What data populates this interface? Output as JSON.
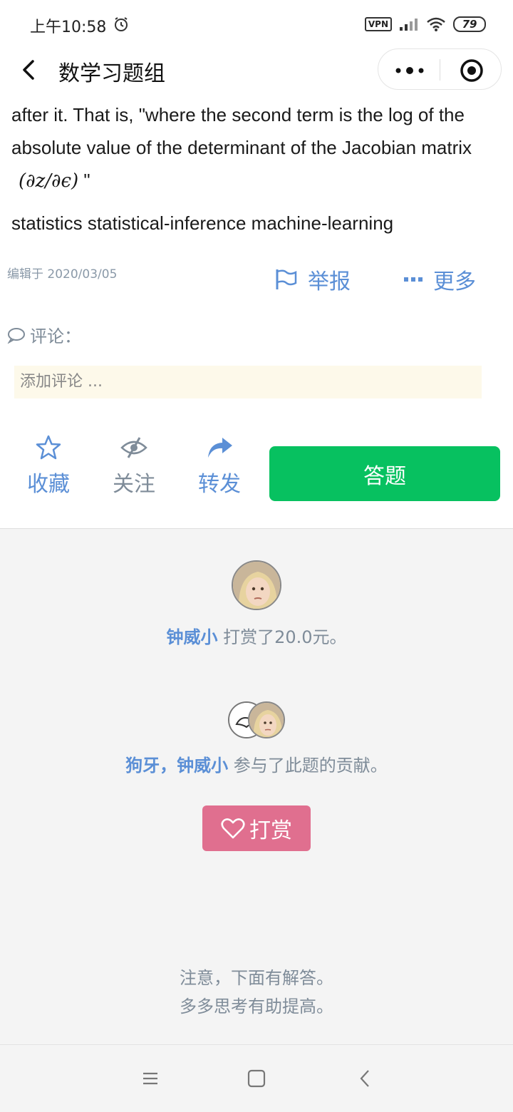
{
  "status": {
    "time": "上午10:58",
    "vpn": "VPN",
    "battery": "79"
  },
  "nav": {
    "title": "数学习题组"
  },
  "content": {
    "line1": "after it. That is, \"where the second term is the log of the",
    "line2": "absolute value of the determinant of the Jacobian matrix",
    "math": "(∂z/∂ϵ)",
    "math_tail": " \"",
    "tags": "statistics statistical-inference machine-learning"
  },
  "meta": {
    "edited": "编辑于 2020/03/05",
    "report": "举报",
    "more": "更多"
  },
  "comments": {
    "label": "评论：",
    "placeholder": "添加评论 ..."
  },
  "actions": {
    "favorite": "收藏",
    "follow": "关注",
    "share": "转发",
    "answer": "答题"
  },
  "reward": {
    "user": "钟威小",
    "text": " 打赏了20.0元。"
  },
  "contributors": {
    "user1": "狗牙",
    "sep": "，",
    "user2": "钟威小",
    "text": " 参与了此题的贡献。"
  },
  "tip_button": "打赏",
  "note": {
    "line1": "注意，下面有解答。",
    "line2": "多多思考有助提高。"
  },
  "colors": {
    "accent": "#5b8fd6",
    "green": "#07c160",
    "pink": "#e06f8f",
    "muted": "#7f8c99"
  }
}
